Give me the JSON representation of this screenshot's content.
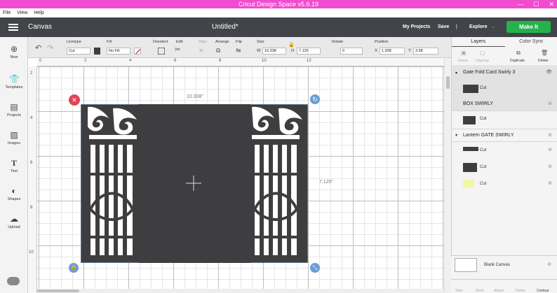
{
  "window": {
    "title": "Cricut Design Space  v5.6.19",
    "controls": [
      "—",
      "☐",
      "✕"
    ]
  },
  "menu": [
    "File",
    "View",
    "Help"
  ],
  "header": {
    "canvas_label": "Canvas",
    "doc_title": "Untitled*",
    "my_projects": "My Projects",
    "save": "Save",
    "separator": "|",
    "explore": "Explore",
    "make_it": "Make It",
    "accent": "#25b24d"
  },
  "toolbar": {
    "undo": "↶",
    "redo": "↷",
    "linetype_label": "Linetype",
    "linetype_value": "Cut",
    "fill_label": "Fill",
    "fill_value": "No Fill",
    "deselect_label": "Deselect",
    "edit_label": "Edit",
    "align_label": "Align",
    "arrange_label": "Arrange",
    "flip_label": "Flip",
    "size_label": "Size",
    "w_label": "W",
    "w_value": "10.338",
    "h_label": "H",
    "h_value": "7.125",
    "rotate_label": "Rotate",
    "rotate_value": "0",
    "position_label": "Position",
    "x_label": "X",
    "x_value": "1.938",
    "y_label": "Y",
    "y_value": "3.58"
  },
  "leftbar": [
    {
      "label": "New",
      "icon": "plus-circle-icon"
    },
    {
      "label": "Templates",
      "icon": "shirt-icon"
    },
    {
      "label": "Projects",
      "icon": "projects-icon"
    },
    {
      "label": "Images",
      "icon": "images-icon"
    },
    {
      "label": "Text",
      "icon": "text-icon"
    },
    {
      "label": "Shapes",
      "icon": "shapes-icon"
    },
    {
      "label": "Upload",
      "icon": "cloud-upload-icon"
    }
  ],
  "rulers": {
    "horizontal": [
      "0",
      "2",
      "4",
      "6",
      "8",
      "10",
      "12"
    ],
    "vertical": [
      "2",
      "4",
      "6",
      "8",
      "10"
    ]
  },
  "canvas": {
    "width_dim": "10.338\"",
    "height_dim": "7.125\"",
    "design_color": "#3e3e40"
  },
  "right_panel": {
    "tab_layers": "Layers",
    "tab_color_sync": "Color Sync",
    "actions": [
      "Group",
      "Ungroup",
      "Duplicate",
      "Delete"
    ],
    "groups": [
      {
        "name": "Gate Fold Card Swirly 3",
        "items": [
          {
            "label": "Cut"
          }
        ]
      },
      {
        "name": "BOX SWIRLY",
        "items": [
          {
            "label": "Cut"
          }
        ]
      },
      {
        "name": "Lantern GATE SWIRLY",
        "items": [
          {
            "label": "Cut"
          },
          {
            "label": "Cut"
          },
          {
            "label": "Cut"
          }
        ]
      }
    ],
    "blank_canvas": "Blank Canvas",
    "bottom_actions": [
      "Slice",
      "Weld",
      "Attach",
      "Flatten",
      "Contour"
    ]
  }
}
